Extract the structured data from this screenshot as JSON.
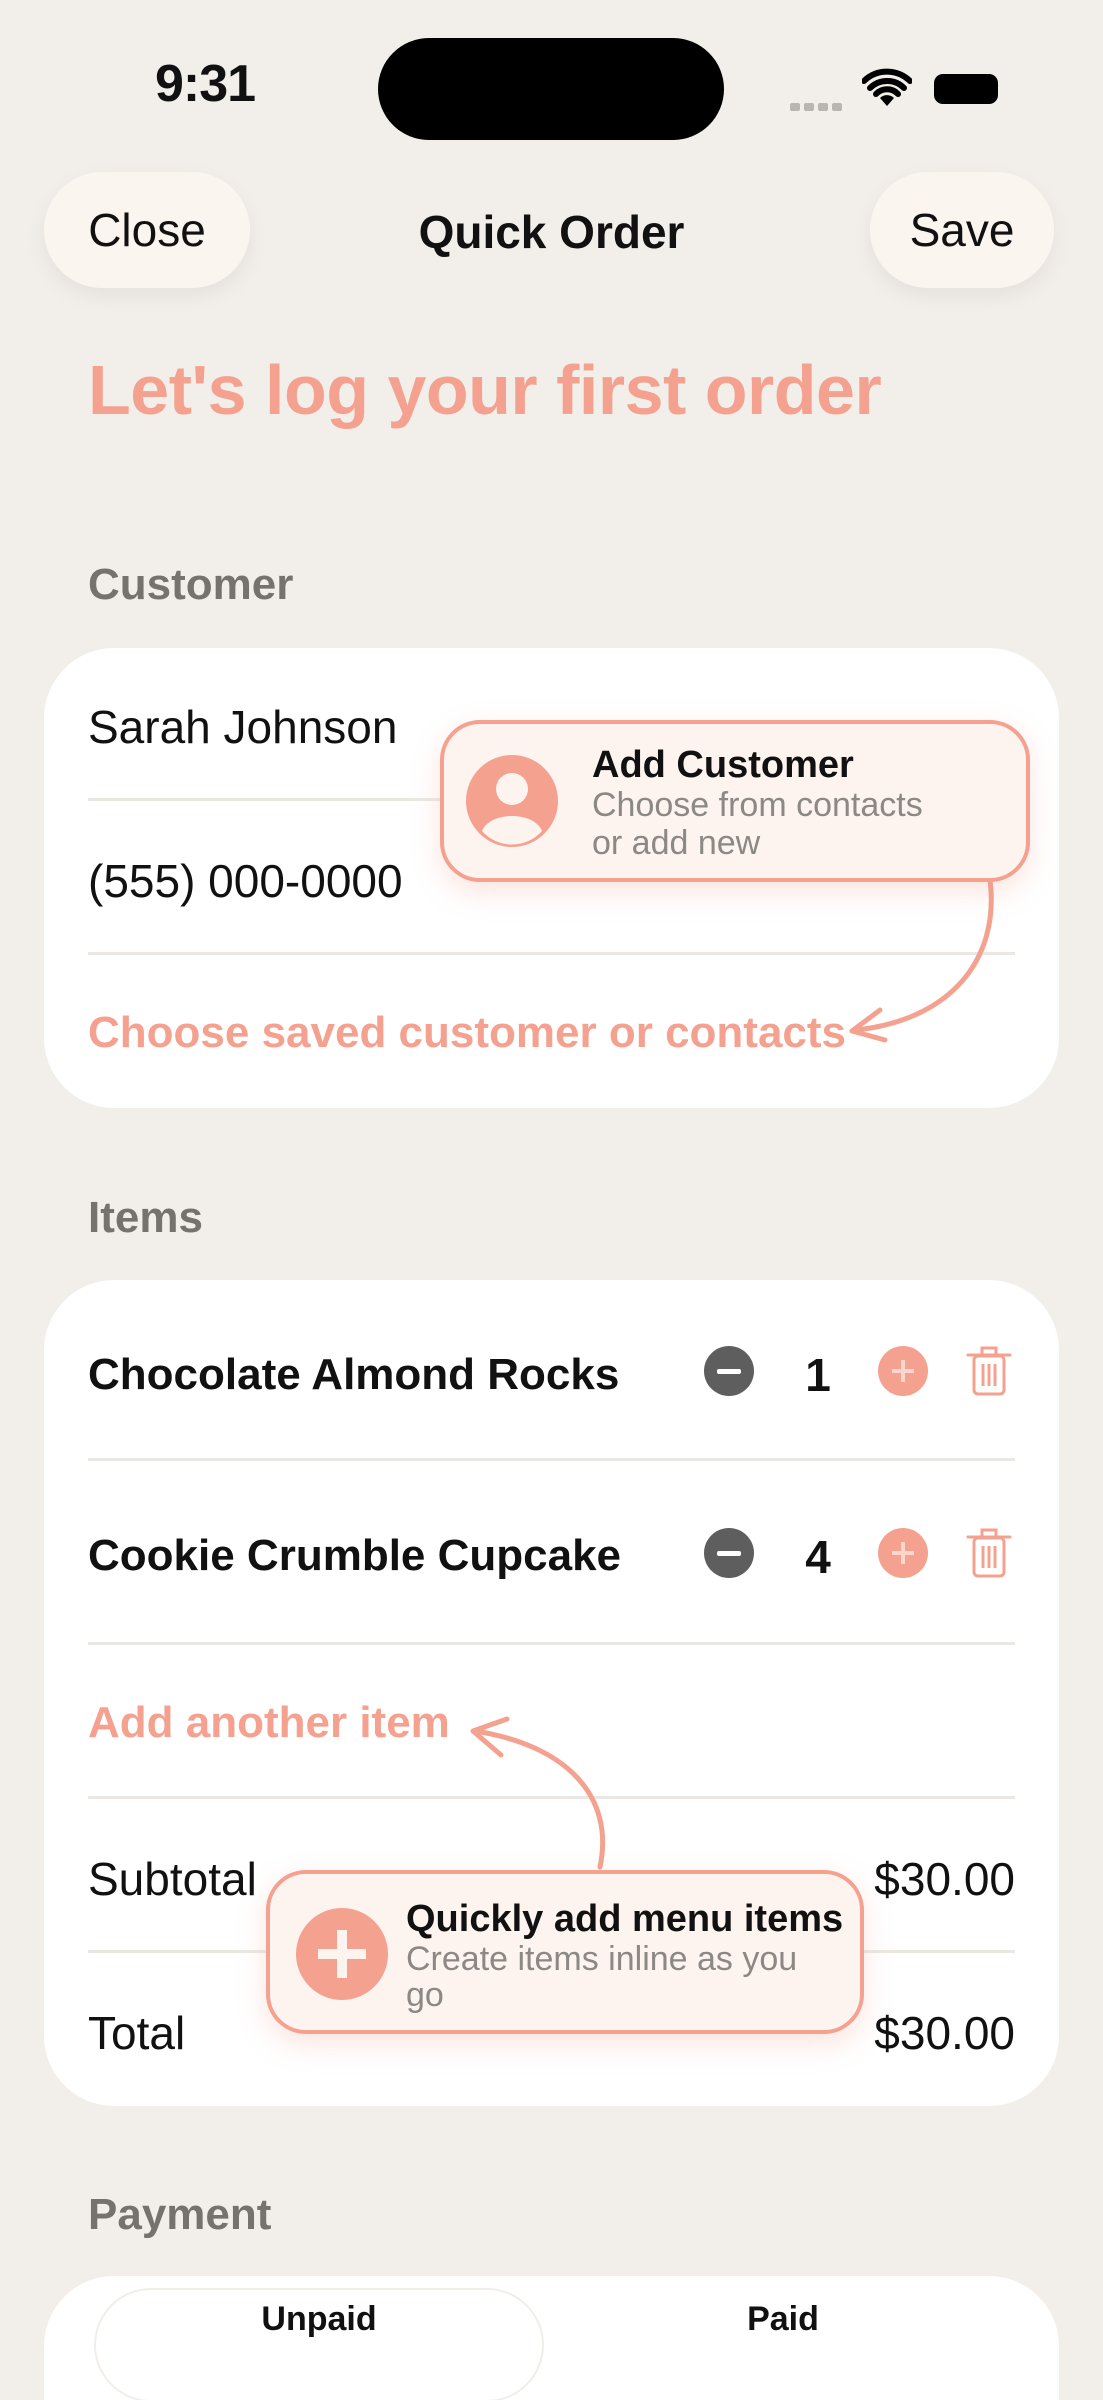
{
  "status_bar": {
    "time": "9:31"
  },
  "nav": {
    "close_label": "Close",
    "title": "Quick Order",
    "save_label": "Save"
  },
  "headline": "Let's log your first order",
  "customer": {
    "section_label": "Customer",
    "name_value": "Sarah Johnson",
    "phone_placeholder": "(555) 000-0000",
    "choose_link": "Choose saved customer or contacts"
  },
  "customer_tip": {
    "title": "Add Customer",
    "subtitle_line1": "Choose from contacts",
    "subtitle_line2": "or add new",
    "icon": "person-icon"
  },
  "items": {
    "section_label": "Items",
    "rows": [
      {
        "name": "Chocolate Almond Rocks",
        "qty": "1"
      },
      {
        "name": "Cookie Crumble Cupcake",
        "qty": "4"
      }
    ],
    "add_link": "Add another item",
    "subtotal_label": "Subtotal",
    "subtotal_value": "$30.00",
    "total_label": "Total",
    "total_value": "$30.00"
  },
  "items_tip": {
    "title": "Quickly add menu items",
    "subtitle_line1": "Create items inline as you",
    "subtitle_line2": "go",
    "icon": "plus-icon"
  },
  "payment": {
    "section_label": "Payment",
    "options": [
      "Unpaid",
      "Paid"
    ],
    "selected": "Unpaid"
  },
  "colors": {
    "accent": "#f4a190",
    "background": "#f2efea",
    "card": "#ffffff",
    "muted": "#76736f"
  }
}
